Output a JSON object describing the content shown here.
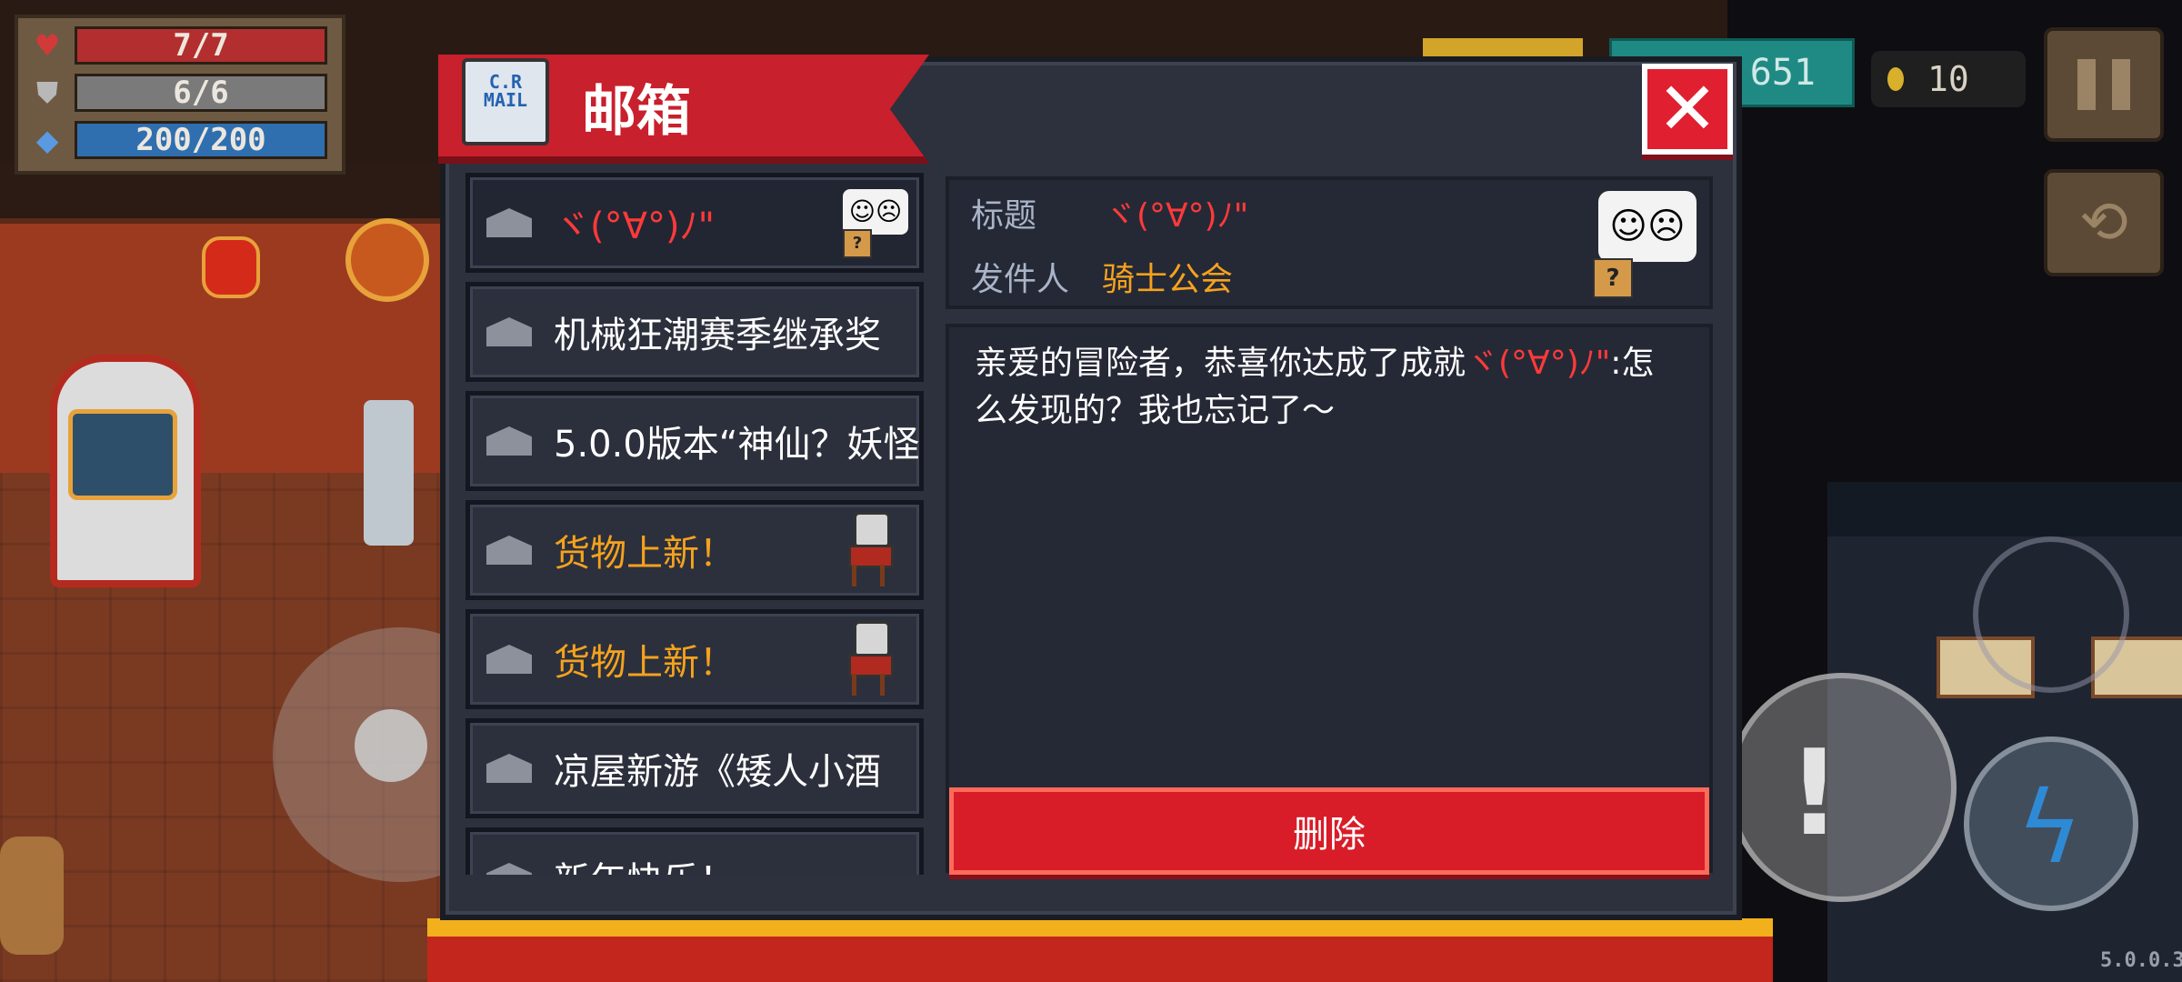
{
  "hud": {
    "health": "7/7",
    "armor": "6/6",
    "energy": "200/200"
  },
  "currency": {
    "gems": "651",
    "coins": "10"
  },
  "icons": {
    "health": "heart-icon",
    "armor": "shield-icon",
    "energy": "diamond-icon",
    "coin": "coin-icon",
    "pause": "pause-icon",
    "swap": "swap-weapon-icon",
    "close": "close-icon",
    "mail": "mail-icon",
    "envelope": "envelope-icon"
  },
  "mailbox": {
    "title": "邮箱",
    "icon_text": "C.R\nMAIL",
    "mails": [
      {
        "subject": "ヾ(°∀°)ﾉ\"",
        "color": "red",
        "attachment": "emoji",
        "selected": true
      },
      {
        "subject": "机械狂潮赛季继承奖",
        "color": "white",
        "attachment": "none"
      },
      {
        "subject": "5.0.0版本“神仙？妖怪",
        "color": "white",
        "attachment": "none"
      },
      {
        "subject": "货物上新！",
        "color": "orange",
        "attachment": "chair"
      },
      {
        "subject": "货物上新！",
        "color": "orange",
        "attachment": "chair"
      },
      {
        "subject": "凉屋新游《矮人小酒",
        "color": "white",
        "attachment": "none"
      },
      {
        "subject": "新年快乐！",
        "color": "white",
        "attachment": "none"
      }
    ],
    "detail": {
      "subject_label": "标题",
      "subject_value": "ヾ(°∀°)ﾉ\"",
      "sender_label": "发件人",
      "sender_value": "骑士公会",
      "body_prefix": "亲爱的冒险者，恭喜你达成了成就",
      "body_highlight": "ヾ(°∀°)ﾉ\"",
      "body_suffix": ":怎么发现的？我也忘记了～"
    },
    "delete_label": "删除"
  },
  "version": "5.0.0.3",
  "colors": {
    "accent_red": "#d81c28",
    "highlight_red": "#ff3a3a",
    "highlight_orange": "#f5a21e",
    "panel": "#2d313d"
  }
}
